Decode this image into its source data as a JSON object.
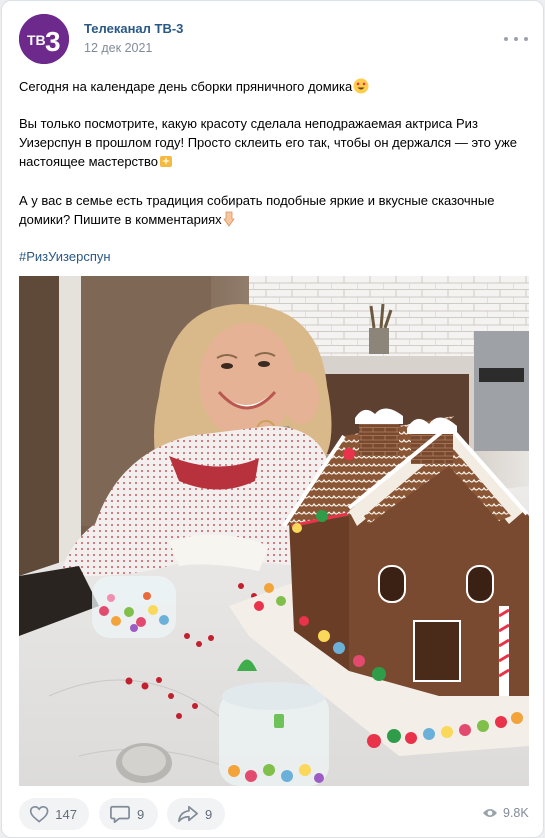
{
  "post": {
    "author": "Телеканал ТВ-3",
    "date": "12 дек 2021",
    "avatar_text": "ТВ3",
    "paragraphs": [
      "Сегодня на календаре день сборки пряничного домика",
      "Вы только посмотрите, какую красоту сделала неподражаемая актриса Риз Уизерспун в прошлом году! Просто склеить его так, чтобы он держался — это уже настоящее мастерство",
      "А у вас в семье есть традиция собирать подобные яркие и вкусные сказочные домики? Пишите в комментариях"
    ],
    "hashtag": "#РизУизерспун"
  },
  "stats": {
    "likes": "147",
    "comments": "9",
    "shares": "9",
    "views": "9.8K"
  },
  "icons": {
    "more": "more-dots-icon",
    "like": "heart-icon",
    "comment": "comment-icon",
    "share": "share-arrow-icon",
    "views": "eye-icon",
    "emoji1": "heart-eyes-emoji",
    "emoji2": "sparkle-emoji",
    "emoji3": "pointing-down-emoji"
  },
  "colors": {
    "brand": "#6d2a8c",
    "link": "#2a5885",
    "muted": "#818c99"
  }
}
